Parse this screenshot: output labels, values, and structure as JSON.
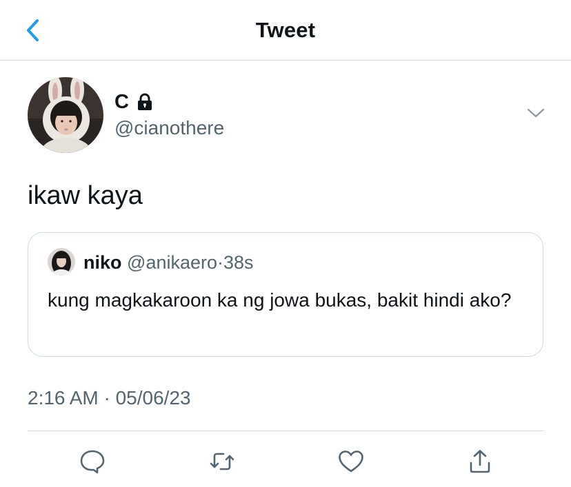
{
  "nav": {
    "title": "Tweet",
    "back_icon": "chevron-left-icon"
  },
  "tweet": {
    "author": {
      "display_name": "C",
      "handle": "@cianothere",
      "protected_icon": "lock-icon"
    },
    "text": "ikaw kaya",
    "timestamp": "2:16 AM · 05/06/23"
  },
  "quote": {
    "name": "niko",
    "handle": "@anikaero",
    "separator": "·",
    "time": "38s",
    "text": "kung magkakaroon ka ng jowa bukas, bakit hindi ako?"
  },
  "actions": [
    "reply-icon",
    "retweet-icon",
    "like-icon",
    "share-icon"
  ],
  "colors": {
    "accent": "#1d9bf0",
    "secondary_text": "#536471",
    "primary_text": "#0f1419",
    "border": "#cfd9de"
  }
}
